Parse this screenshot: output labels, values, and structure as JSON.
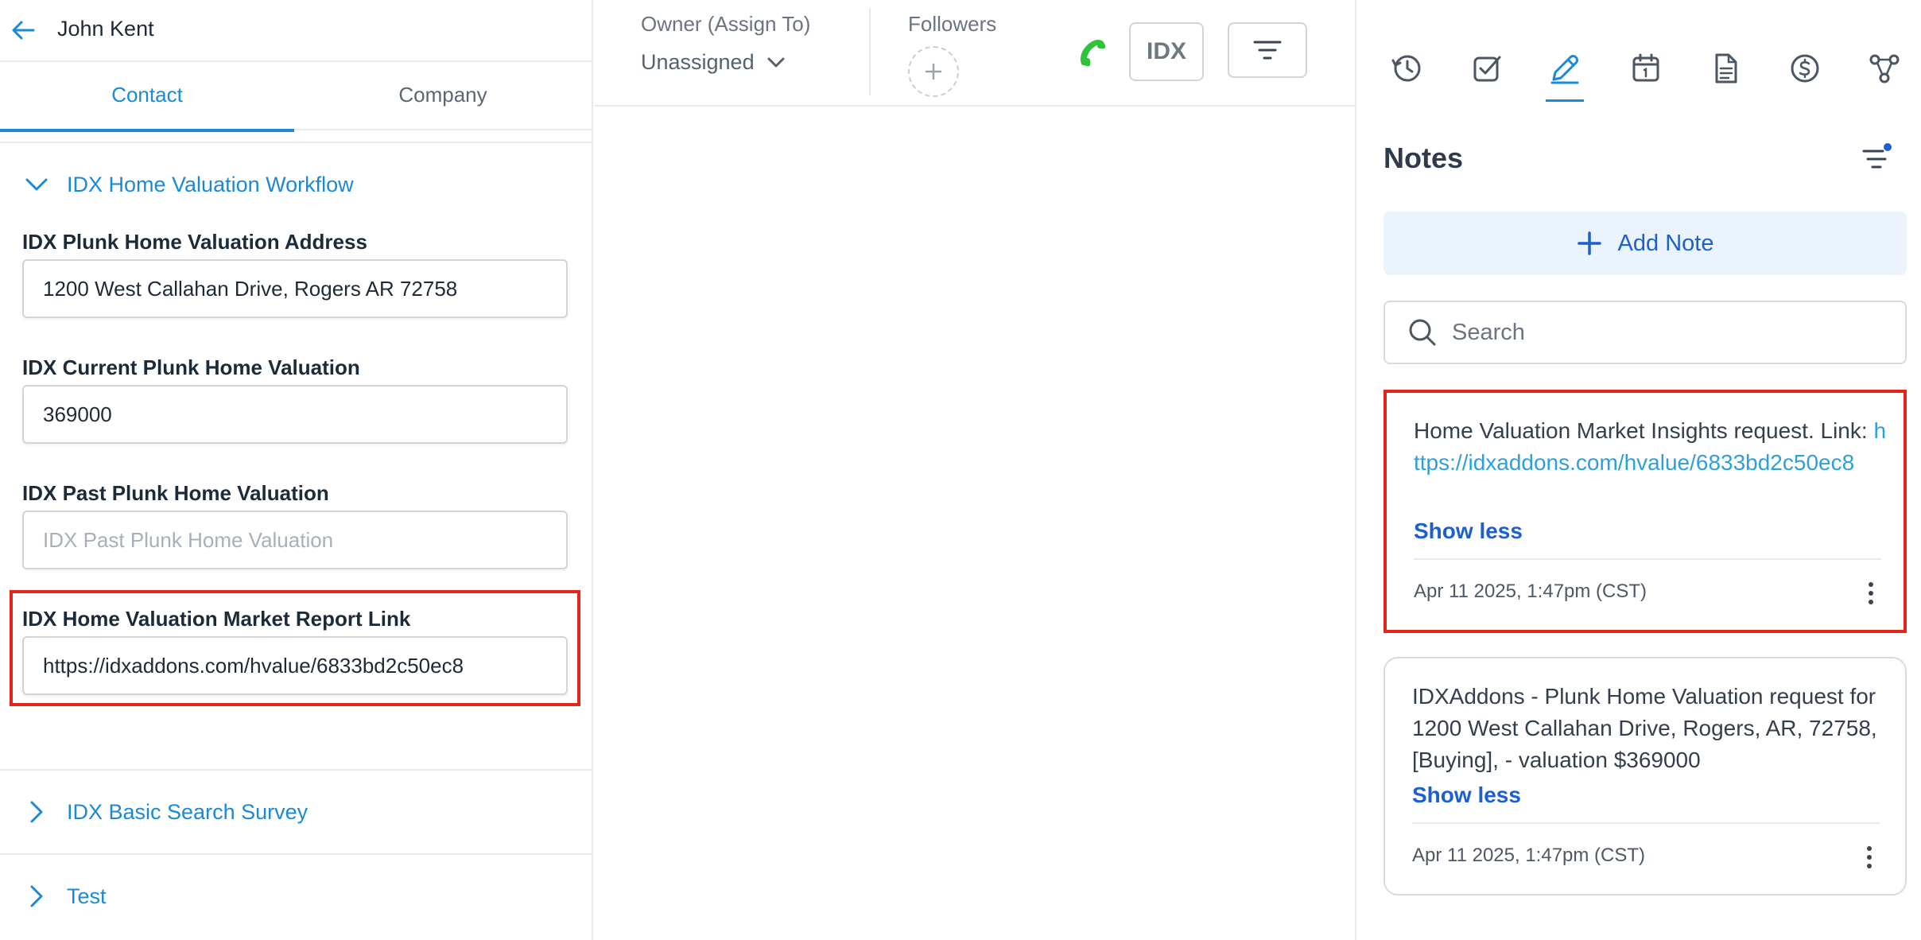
{
  "header": {
    "contact_name": "John Kent"
  },
  "tabs": [
    {
      "label": "Contact",
      "active": true
    },
    {
      "label": "Company",
      "active": false
    }
  ],
  "sections": {
    "workflow_title": "IDX Home Valuation Workflow",
    "basic_search_title": "IDX Basic Search Survey",
    "test_title": "Test"
  },
  "fields": [
    {
      "label": "IDX Plunk Home Valuation Address",
      "value": "1200 West Callahan Drive, Rogers AR 72758",
      "placeholder": ""
    },
    {
      "label": "IDX Current Plunk Home Valuation",
      "value": "369000",
      "placeholder": ""
    },
    {
      "label": "IDX Past Plunk Home Valuation",
      "value": "",
      "placeholder": "IDX Past Plunk Home Valuation"
    },
    {
      "label": "IDX Home Valuation Market Report Link",
      "value": "https://idxaddons.com/hvalue/6833bd2c50ec8",
      "placeholder": ""
    }
  ],
  "toolbar": {
    "owner_label": "Owner (Assign To)",
    "owner_value": "Unassigned",
    "followers_label": "Followers",
    "idx_label": "IDX"
  },
  "right_tabs": [
    {
      "icon": "history-icon",
      "active": false
    },
    {
      "icon": "task-check-icon",
      "active": false
    },
    {
      "icon": "pencil-icon",
      "active": true
    },
    {
      "icon": "calendar-icon",
      "active": false
    },
    {
      "icon": "document-icon",
      "active": false
    },
    {
      "icon": "dollar-icon",
      "active": false
    },
    {
      "icon": "workflow-icon",
      "active": false
    }
  ],
  "notes": {
    "title": "Notes",
    "add_label": "Add Note",
    "search_placeholder": "Search",
    "items": [
      {
        "text": "Home Valuation Market Insights request. Link: ",
        "link": "https://idxaddons.com/hvalue/6833bd2c50ec8",
        "toggle": "Show less",
        "date": "Apr 11 2025, 1:47pm (CST)"
      },
      {
        "text": "IDXAddons - Plunk Home Valuation request for 1200 West Callahan Drive, Rogers, AR, 72758, [Buying], - valuation $369000",
        "toggle": "Show less",
        "date": "Apr 11 2025, 1:47pm (CST)"
      }
    ]
  },
  "colors": {
    "accent": "#1a8ad6",
    "link": "#1b5fd1",
    "highlight": "#e3261b",
    "phone": "#2fc23a"
  }
}
